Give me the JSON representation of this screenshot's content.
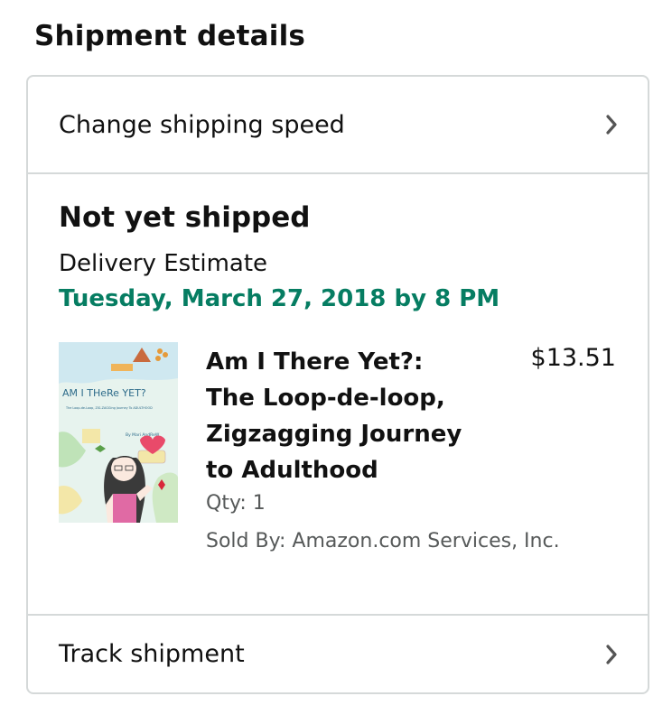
{
  "page": {
    "title": "Shipment details"
  },
  "change_speed": {
    "label": "Change shipping speed",
    "icon": "chevron-right-icon"
  },
  "shipment": {
    "status": "Not yet shipped",
    "estimate_label": "Delivery Estimate",
    "estimate_date": "Tuesday, March 27, 2018 by 8 PM",
    "estimate_color": "#067d62"
  },
  "item": {
    "title": "Am I There Yet?: The Loop-de-loop, Zigzagging Journey to Adulthood",
    "price": "$13.51",
    "qty": "Qty: 1",
    "sold_by": "Sold By: Amazon.com Services, Inc.",
    "cover": {
      "title": "AM I THeRe YET?",
      "subtitle": "The Loop-de-Loop, ZIG-ZAGGing Journey To ADULTHOOD",
      "author": "By Mari AndReW"
    }
  },
  "track": {
    "label": "Track shipment",
    "icon": "chevron-right-icon"
  }
}
